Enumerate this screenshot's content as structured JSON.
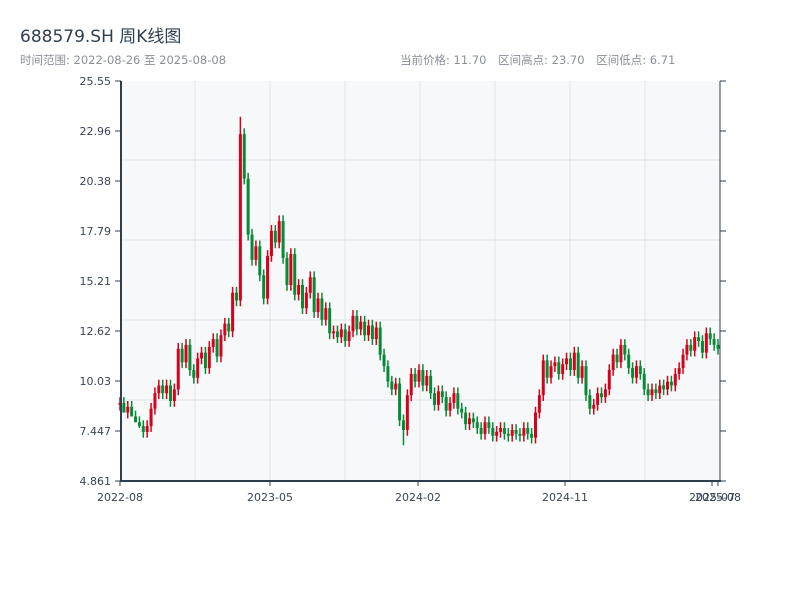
{
  "title": "688579.SH 周K线图",
  "subtitle": "时间范围: 2022-08-26 至 2025-08-08",
  "stats": {
    "current": "当前价格: 11.70",
    "high": "区间高点: 23.70",
    "low": "区间低点: 6.71"
  },
  "colors": {
    "up": "#d9001b",
    "down": "#078a35",
    "plot_bg": "#f6f8fa",
    "axis": "#2d3e50",
    "grid": "#e1e4e8"
  },
  "chart_data": {
    "type": "candlestick",
    "period": "weekly",
    "start": "2022-08-26",
    "end": "2025-08-08",
    "ylim": [
      4.861,
      25.55
    ],
    "y_ticks": [
      "4.861",
      "7.447",
      "10.03",
      "12.62",
      "15.21",
      "17.79",
      "20.38",
      "22.96",
      "25.55"
    ],
    "x_ticks": [
      "2022-08",
      "2023-05",
      "2024-02",
      "2024-11",
      "2025-07",
      "2025-08"
    ],
    "grid": true,
    "up_color_meaning": "red = rising, green = falling",
    "open": [
      8.8,
      8.9,
      8.4,
      8.7,
      8.2,
      7.9,
      7.7,
      7.4,
      7.7,
      8.6,
      9.4,
      9.8,
      9.4,
      9.8,
      9.0,
      9.6,
      11.7,
      11.0,
      11.9,
      10.6,
      10.2,
      11.2,
      11.5,
      10.7,
      11.8,
      12.2,
      11.3,
      12.4,
      13.0,
      12.6,
      14.6,
      14.2,
      22.8,
      20.5,
      17.6,
      16.3,
      17.0,
      15.5,
      14.3,
      16.5,
      17.8,
      17.2,
      18.3,
      16.4,
      15.0,
      16.6,
      14.5,
      15.0,
      13.8,
      14.6,
      15.4,
      13.6,
      14.3,
      13.2,
      13.8,
      12.5,
      12.6,
      12.3,
      12.7,
      12.1,
      12.6,
      13.4,
      12.7,
      13.1,
      12.4,
      12.9,
      12.2,
      12.8,
      11.4,
      10.8,
      10.0,
      9.6,
      9.9,
      8.0,
      7.5,
      9.3,
      10.4,
      10.0,
      10.6,
      9.8,
      10.3,
      9.4,
      8.8,
      9.5,
      9.2,
      8.5,
      8.9,
      9.4,
      8.6,
      8.4,
      7.8,
      8.1,
      7.9,
      7.6,
      7.3,
      7.9,
      7.6,
      7.2,
      7.4,
      7.6,
      7.3,
      7.2,
      7.5,
      7.3,
      7.2,
      7.6,
      7.3,
      7.1,
      8.4,
      9.3,
      11.1,
      10.2,
      10.8,
      11.0,
      10.4,
      10.9,
      11.2,
      10.6,
      11.5,
      10.2,
      10.8,
      9.3,
      8.6,
      8.8,
      9.4,
      9.2,
      9.6,
      10.6,
      11.4,
      11.0,
      11.9,
      11.4,
      10.7,
      10.2,
      10.8,
      10.4,
      9.6,
      9.3,
      9.6,
      9.4,
      9.8,
      9.6,
      10.0,
      9.8,
      10.4,
      10.7,
      11.4,
      11.9,
      11.6,
      12.3,
      12.1,
      11.5,
      12.5,
      12.2,
      11.9
    ],
    "high": [
      9.2,
      9.2,
      9.0,
      9.0,
      8.5,
      8.2,
      8.0,
      8.0,
      8.9,
      9.7,
      10.1,
      10.1,
      10.1,
      10.1,
      9.9,
      12.0,
      12.0,
      12.2,
      12.2,
      10.9,
      11.5,
      11.8,
      11.8,
      12.1,
      12.5,
      12.5,
      12.7,
      13.3,
      13.3,
      14.9,
      14.9,
      23.7,
      23.1,
      20.8,
      17.9,
      17.3,
      17.3,
      15.8,
      16.8,
      18.1,
      18.1,
      18.6,
      18.6,
      16.7,
      16.9,
      16.9,
      15.3,
      15.3,
      14.9,
      15.7,
      15.7,
      14.6,
      14.6,
      14.1,
      14.1,
      12.9,
      12.9,
      13.0,
      13.0,
      12.9,
      13.7,
      13.7,
      13.4,
      13.4,
      13.2,
      13.2,
      13.1,
      13.1,
      11.7,
      11.1,
      10.3,
      10.2,
      10.2,
      8.3,
      9.6,
      10.7,
      10.7,
      10.9,
      10.9,
      10.6,
      10.6,
      9.7,
      9.8,
      9.8,
      9.5,
      9.2,
      9.7,
      9.7,
      8.9,
      8.7,
      8.4,
      8.4,
      8.2,
      7.9,
      8.2,
      8.2,
      7.9,
      7.7,
      7.9,
      7.9,
      7.6,
      7.8,
      7.8,
      7.6,
      7.9,
      7.9,
      7.6,
      8.7,
      9.6,
      11.4,
      11.4,
      11.1,
      11.3,
      11.3,
      11.2,
      11.5,
      11.5,
      11.8,
      11.8,
      11.1,
      11.1,
      9.6,
      9.1,
      9.7,
      9.7,
      9.9,
      10.9,
      11.7,
      11.7,
      12.2,
      12.2,
      11.7,
      11.0,
      11.1,
      11.1,
      10.7,
      9.9,
      9.9,
      9.9,
      10.1,
      10.1,
      10.3,
      10.3,
      10.7,
      11.0,
      11.7,
      12.2,
      12.2,
      12.6,
      12.6,
      12.4,
      12.8,
      12.8,
      12.5,
      12.2
    ],
    "low": [
      8.5,
      8.6,
      8.1,
      8.4,
      7.9,
      7.6,
      7.1,
      7.1,
      7.4,
      8.3,
      9.1,
      9.1,
      9.1,
      8.7,
      8.7,
      9.3,
      10.7,
      10.7,
      10.3,
      9.9,
      9.9,
      10.9,
      10.4,
      10.4,
      11.5,
      11.0,
      11.0,
      12.1,
      12.3,
      12.3,
      13.9,
      13.9,
      20.2,
      17.3,
      16.0,
      16.0,
      15.2,
      14.0,
      14.0,
      16.2,
      16.9,
      16.9,
      16.1,
      14.7,
      14.7,
      14.2,
      14.2,
      13.5,
      13.5,
      14.3,
      13.3,
      13.3,
      12.9,
      12.9,
      12.2,
      12.2,
      12.0,
      12.0,
      11.8,
      11.8,
      12.3,
      12.4,
      12.4,
      12.1,
      12.1,
      11.9,
      11.9,
      11.1,
      10.5,
      9.7,
      9.3,
      9.3,
      7.7,
      6.71,
      7.2,
      9.0,
      9.7,
      9.7,
      9.5,
      9.5,
      9.1,
      8.5,
      8.5,
      8.9,
      8.2,
      8.2,
      8.6,
      8.3,
      8.1,
      7.5,
      7.5,
      7.6,
      7.3,
      7.0,
      7.0,
      7.3,
      6.9,
      6.9,
      7.1,
      7.0,
      6.9,
      6.9,
      7.0,
      6.9,
      6.9,
      7.0,
      6.8,
      6.8,
      8.1,
      9.0,
      9.9,
      9.9,
      10.5,
      10.1,
      10.1,
      10.6,
      10.3,
      10.3,
      9.9,
      9.9,
      9.0,
      8.3,
      8.3,
      8.5,
      8.9,
      8.9,
      9.3,
      10.3,
      10.7,
      10.7,
      11.1,
      10.4,
      9.9,
      9.9,
      10.1,
      9.3,
      9.0,
      9.0,
      9.1,
      9.1,
      9.3,
      9.3,
      9.5,
      9.5,
      10.1,
      10.4,
      11.1,
      11.3,
      11.3,
      11.8,
      11.2,
      11.2,
      11.9,
      11.6,
      11.4
    ],
    "close": [
      8.9,
      8.4,
      8.7,
      8.2,
      7.9,
      7.7,
      7.4,
      7.7,
      8.6,
      9.4,
      9.8,
      9.4,
      9.8,
      9.0,
      9.6,
      11.7,
      11.0,
      11.9,
      10.6,
      10.2,
      11.2,
      11.5,
      10.7,
      11.8,
      12.2,
      11.3,
      12.4,
      13.0,
      12.6,
      14.6,
      14.2,
      22.8,
      20.5,
      17.6,
      16.3,
      17.0,
      15.5,
      14.3,
      16.5,
      17.8,
      17.2,
      18.3,
      16.4,
      15.0,
      16.6,
      14.5,
      15.0,
      13.8,
      14.6,
      15.4,
      13.6,
      14.3,
      13.2,
      13.8,
      12.5,
      12.6,
      12.3,
      12.7,
      12.1,
      12.6,
      13.4,
      12.7,
      13.1,
      12.4,
      12.9,
      12.2,
      12.8,
      11.4,
      10.8,
      10.0,
      9.6,
      9.9,
      8.0,
      7.5,
      9.3,
      10.4,
      10.0,
      10.6,
      9.8,
      10.3,
      9.4,
      8.8,
      9.5,
      9.2,
      8.5,
      8.9,
      9.4,
      8.6,
      8.4,
      7.8,
      8.1,
      7.9,
      7.6,
      7.3,
      7.9,
      7.6,
      7.2,
      7.4,
      7.6,
      7.3,
      7.2,
      7.5,
      7.3,
      7.2,
      7.6,
      7.3,
      7.1,
      8.4,
      9.3,
      11.1,
      10.2,
      10.8,
      11.0,
      10.4,
      10.9,
      11.2,
      10.6,
      11.5,
      10.2,
      10.8,
      9.3,
      8.6,
      8.8,
      9.4,
      9.2,
      9.6,
      10.6,
      11.4,
      11.0,
      11.9,
      11.4,
      10.7,
      10.2,
      10.8,
      10.4,
      9.6,
      9.3,
      9.6,
      9.4,
      9.8,
      9.6,
      10.0,
      9.8,
      10.4,
      10.7,
      11.4,
      11.9,
      11.6,
      12.3,
      12.1,
      11.5,
      12.5,
      12.2,
      11.9,
      11.7
    ]
  }
}
